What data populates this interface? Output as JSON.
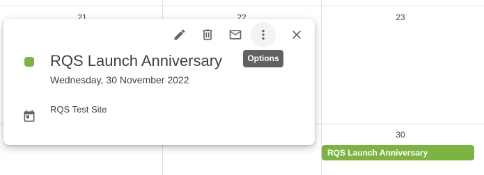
{
  "calendar": {
    "day_numbers": [
      "21",
      "22",
      "23",
      "30"
    ]
  },
  "event_chip": {
    "label": "RQS Launch Anniversary",
    "color": "#7cb342"
  },
  "popover": {
    "toolbar": {
      "edit_icon": "pencil-icon",
      "delete_icon": "trash-icon",
      "email_icon": "mail-icon",
      "options_icon": "more-vert-icon",
      "close_icon": "close-icon",
      "options_tooltip": "Options"
    },
    "title": "RQS Launch Anniversary",
    "date": "Wednesday, 30 November 2022",
    "calendar_name": "RQS Test Site",
    "color": "#7cb342"
  }
}
